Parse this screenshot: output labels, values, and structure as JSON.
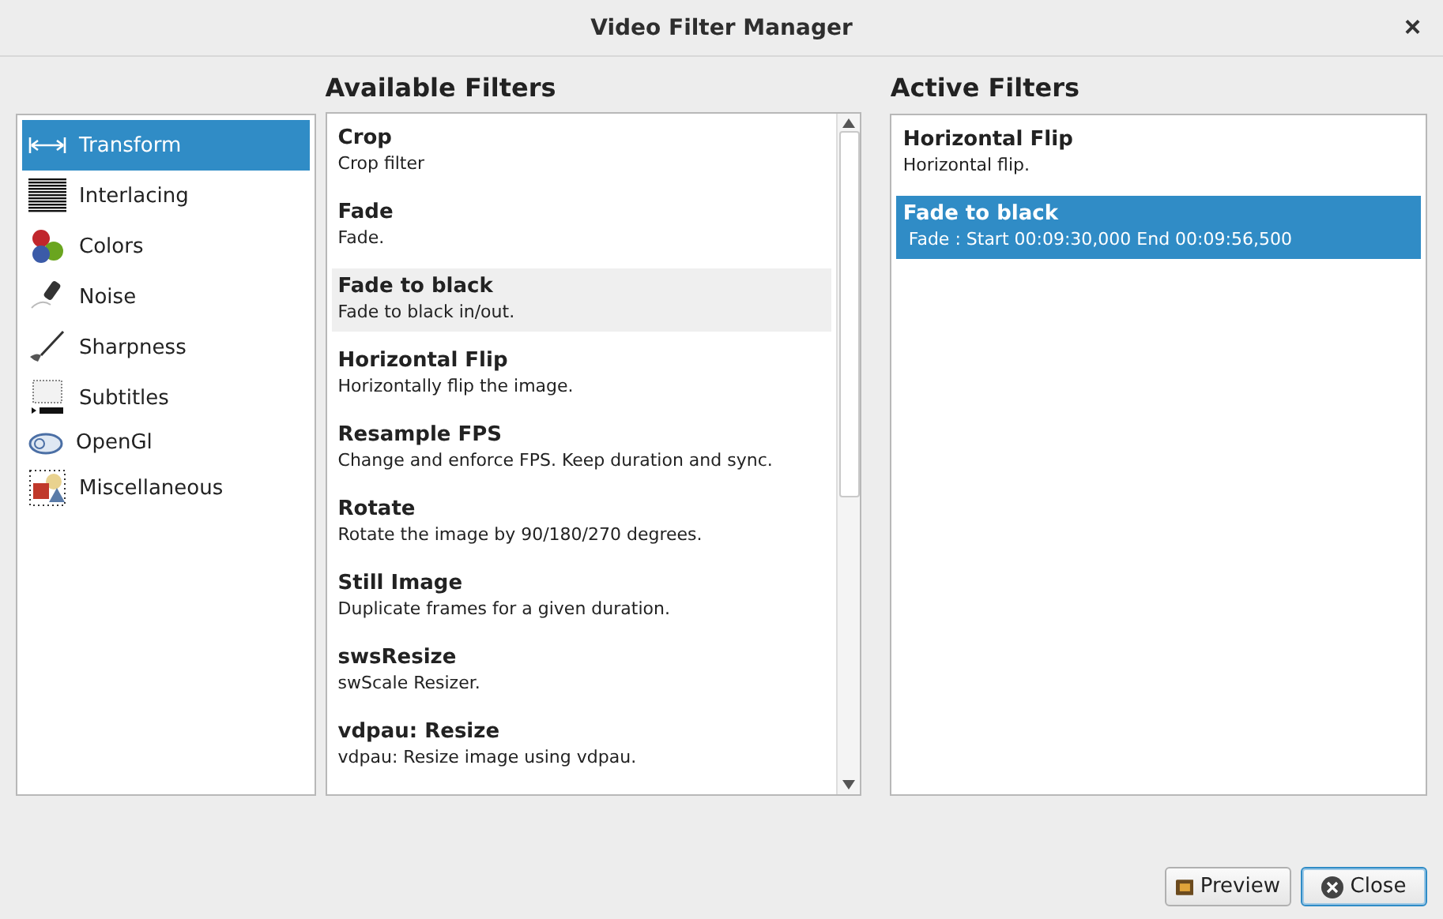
{
  "window": {
    "title": "Video Filter Manager",
    "close": "×"
  },
  "categories": [
    {
      "label": "Transform",
      "selected": true
    },
    {
      "label": "Interlacing",
      "selected": false
    },
    {
      "label": "Colors",
      "selected": false
    },
    {
      "label": "Noise",
      "selected": false
    },
    {
      "label": "Sharpness",
      "selected": false
    },
    {
      "label": "Subtitles",
      "selected": false
    },
    {
      "label": "OpenGl",
      "selected": false
    },
    {
      "label": "Miscellaneous",
      "selected": false
    }
  ],
  "available": {
    "title": "Available Filters",
    "items": [
      {
        "name": "Crop",
        "description": "Crop filter",
        "hovered": false
      },
      {
        "name": "Fade",
        "description": "Fade.",
        "hovered": false
      },
      {
        "name": "Fade to black",
        "description": "Fade to black in/out.",
        "hovered": true
      },
      {
        "name": "Horizontal Flip",
        "description": "Horizontally flip the image.",
        "hovered": false
      },
      {
        "name": "Resample FPS",
        "description": "Change and enforce FPS. Keep duration and sync.",
        "hovered": false
      },
      {
        "name": "Rotate",
        "description": "Rotate the image by 90/180/270 degrees.",
        "hovered": false
      },
      {
        "name": "Still Image",
        "description": "Duplicate frames for a given duration.",
        "hovered": false
      },
      {
        "name": "swsResize",
        "description": "swScale Resizer.",
        "hovered": false
      },
      {
        "name": "vdpau: Resize",
        "description": "vdpau: Resize image using vdpau.",
        "hovered": false
      }
    ]
  },
  "active": {
    "title": "Active Filters",
    "items": [
      {
        "name": "Horizontal Flip",
        "description": "Horizontal flip.",
        "selected": false
      },
      {
        "name": "Fade to black",
        "description": " Fade : Start 00:09:30,000 End 00:09:56,500",
        "selected": true
      }
    ]
  },
  "buttons": [
    {
      "label": "Preview",
      "kind": "preview",
      "focused": false
    },
    {
      "label": "Close",
      "kind": "close",
      "focused": true
    }
  ]
}
